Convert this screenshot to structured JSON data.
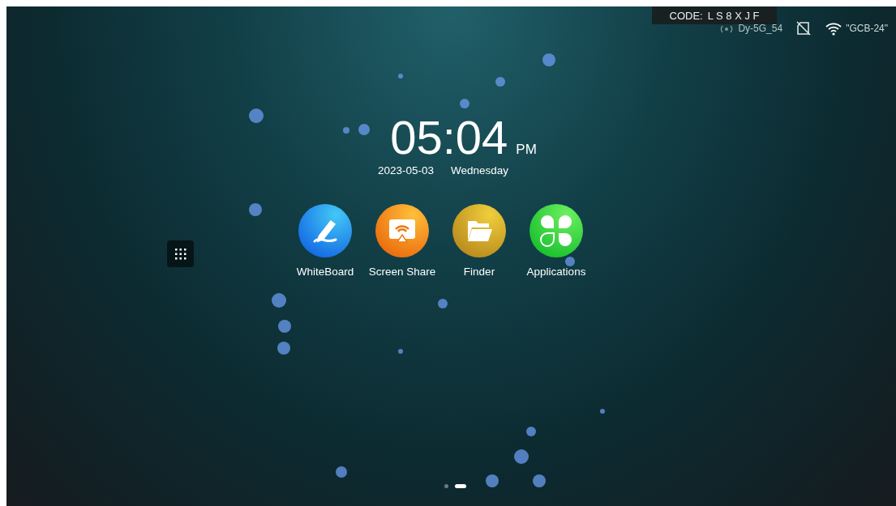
{
  "code_badge": {
    "label": "CODE:",
    "value": "L S 8 X J F"
  },
  "status_bar": {
    "hotspot": "Dy-5G_54",
    "wifi": "\"GCB-24\""
  },
  "clock": {
    "time": "05:04",
    "ampm": "PM",
    "date": "2023-05-03",
    "weekday": "Wednesday"
  },
  "apps": [
    {
      "kind": "whiteboard",
      "label": "WhiteBoard"
    },
    {
      "kind": "screenshare",
      "label": "Screen Share"
    },
    {
      "kind": "finder",
      "label": "Finder"
    },
    {
      "kind": "applications",
      "label": "Applications"
    }
  ],
  "pages": [
    {
      "selected": false
    },
    {
      "selected": true
    }
  ]
}
